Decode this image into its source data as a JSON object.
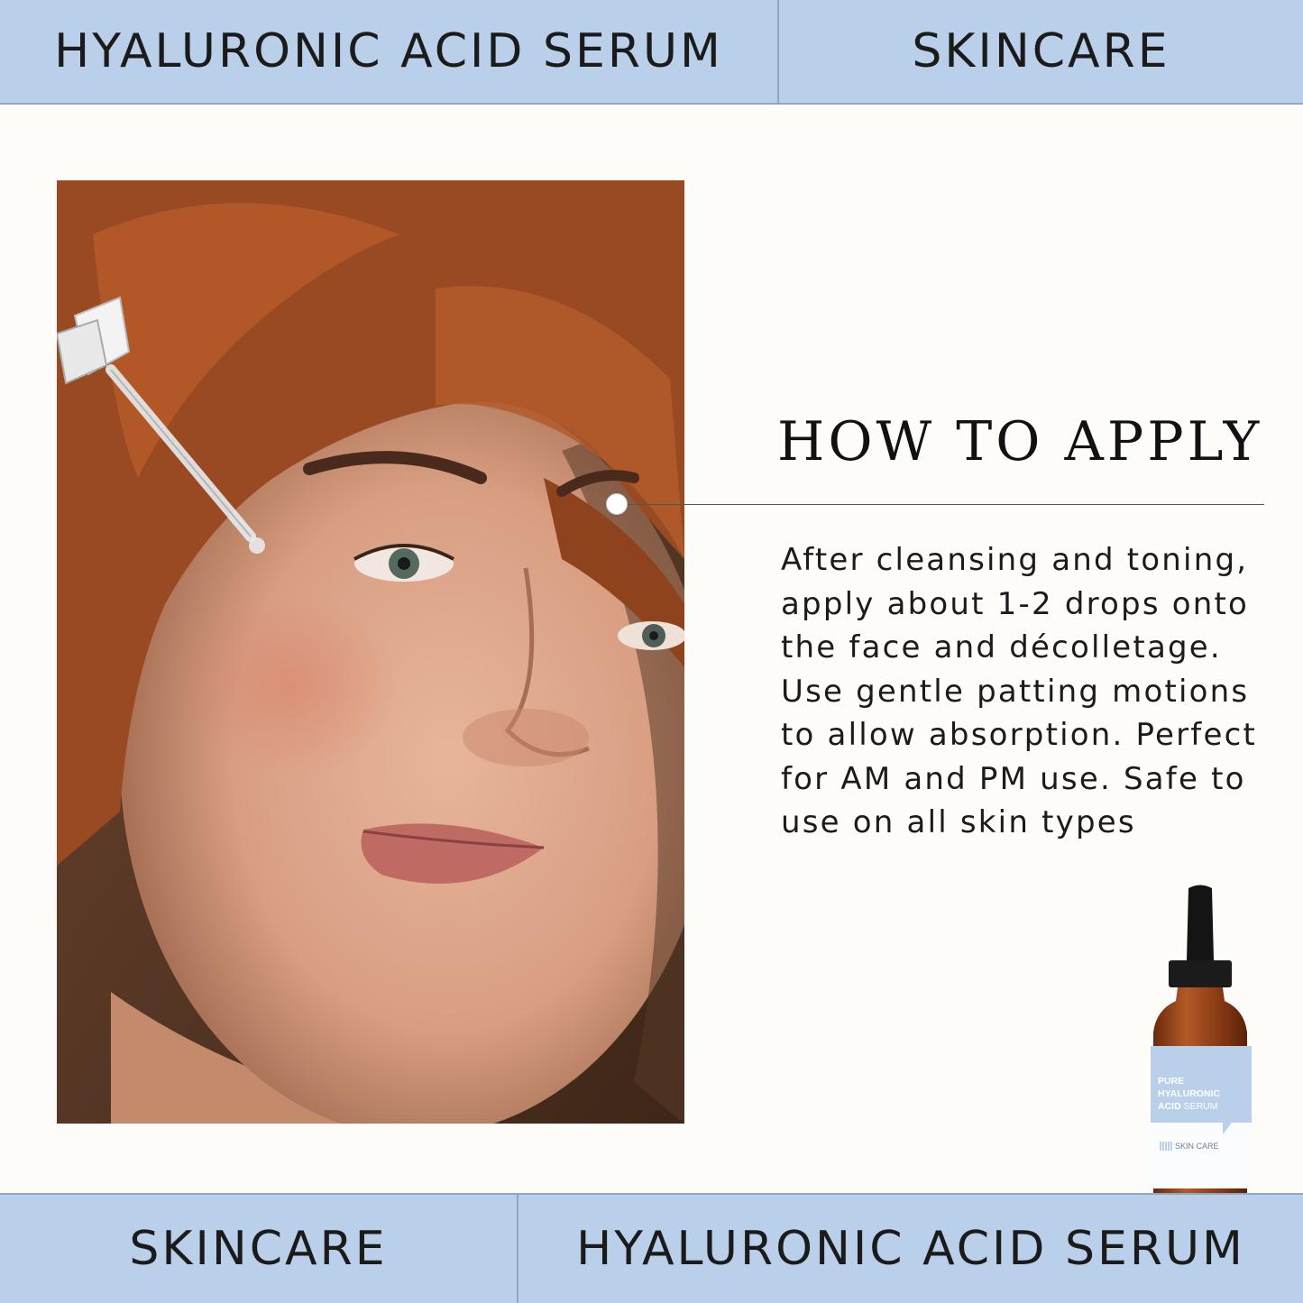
{
  "header": {
    "left_label": "HYALURONIC ACID SERUM",
    "right_label": "SKINCARE"
  },
  "section": {
    "title": "HOW TO APPLY",
    "instructions": "After cleansing and toning, apply about 1-2 drops onto the face and décolletage. Use gentle patting motions to allow absorption. Perfect for AM and PM use. Safe to use on all skin types"
  },
  "product_label": {
    "line1": "PURE",
    "line2": "HYALURONIC",
    "line3_bold": "ACID",
    "line3_light": "SERUM",
    "brand": "SKIN CARE"
  },
  "footer": {
    "left_label": "SKINCARE",
    "right_label": "HYALURONIC ACID SERUM"
  },
  "colors": {
    "band": "#b9cfea",
    "band_border": "#8ea7c6",
    "background": "#fdfcf8",
    "amber_glass": "#8a3a14",
    "cap": "#141414"
  }
}
